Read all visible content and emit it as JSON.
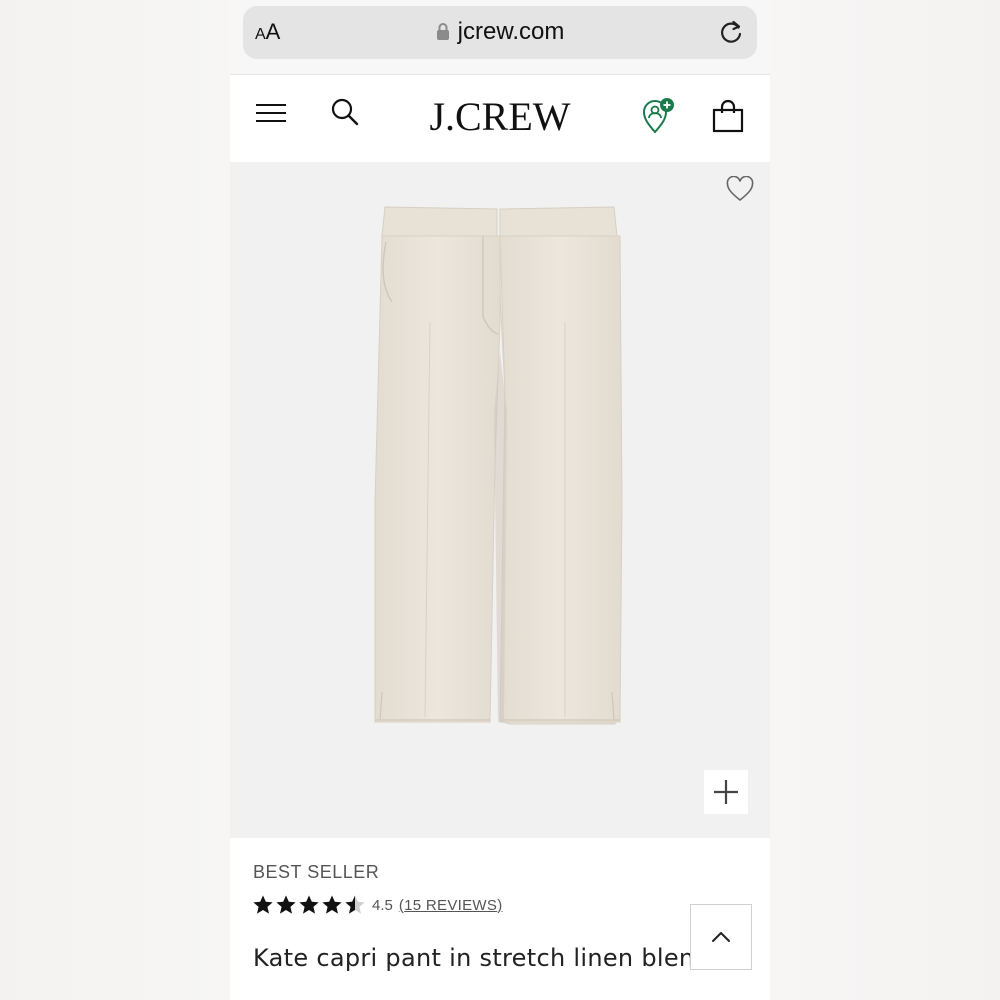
{
  "browser": {
    "text_size_label_small": "A",
    "text_size_label_large": "A",
    "url": "jcrew.com"
  },
  "nav": {
    "logo": "J.CREW"
  },
  "icons": {
    "text_size": "text-size-icon",
    "lock": "lock-icon",
    "reload": "reload-icon",
    "menu": "hamburger-menu-icon",
    "search": "search-icon",
    "account": "account-location-icon",
    "bag": "shopping-bag-icon",
    "wishlist": "heart-icon",
    "zoom": "plus-icon",
    "scroll_top": "chevron-up-icon"
  },
  "product": {
    "badge": "BEST SELLER",
    "rating": "4.5",
    "rating_value": 4.5,
    "rating_max": 5,
    "reviews_label": "15 REVIEWS",
    "name": "Kate capri pant in stretch linen blend"
  },
  "colors": {
    "account_accent": "#1a7a4a",
    "fabric": "#e8e1d7"
  }
}
